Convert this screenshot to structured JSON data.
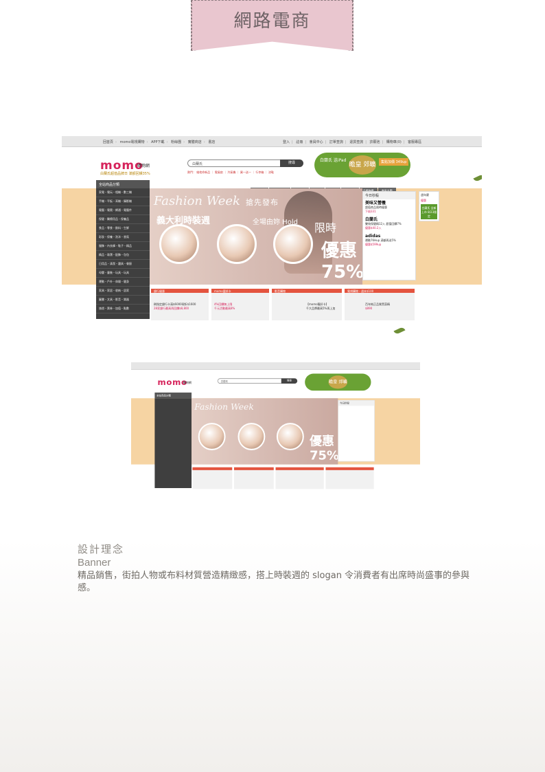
{
  "page_title": "網路電商",
  "screenshot": {
    "topbar_left": [
      "回首頁",
      "momo電視購物",
      "APP下載",
      "粉絲團",
      "實體商店",
      "書店"
    ],
    "topbar_right": [
      "登入",
      "註冊",
      "會員中心",
      "訂單查詢",
      "退貨查詢",
      "許願池",
      "購物車(0)",
      "客服專區"
    ],
    "logo": "momo",
    "logo_cn": "購物網",
    "logo_sub": "白蘭氏超值品牌日 滿額回饋35%",
    "search_value": "白蘭氏",
    "search_button": "搜尋",
    "hot_links": "熱門：  維他命新品 ｜ 電風扇 ｜ 冷氣機 ｜ 買一送一 ｜ 行李箱 ｜ 涼鞋",
    "promo": {
      "left": "白蘭氏 送iPad",
      "center": "瞻皇 郊曠師",
      "right": "集點加價 349up"
    },
    "nav_tabs": [
      "限時搶購",
      "momo書局",
      "超市美妝",
      "品牌日",
      "獨家館",
      "週末特賣",
      "品牌旗艦",
      "會員主題"
    ],
    "category_title": "全站商品分類",
    "categories": [
      "家電・電玩・相機・數三機",
      "手機・平板・耳機・攝影機",
      "電腦・電競・網通・電腦件",
      "保健・醫療用品・保養品",
      "食品・零食・飲料・生鮮",
      "彩妝・保養・洗沐・香氛",
      "服飾・內衣褲・鞋子・精品",
      "精品・珠寶・配飾・包包",
      "日用品・清潔・寢具・餐廚",
      "母嬰・童裝・玩具・玩具",
      "運動・戶外・休閒・健身",
      "家具・家居・收納・居家",
      "圖書・文具・影音・樂器",
      "旅遊・票券・加值・點數"
    ],
    "banner": {
      "script": "Fashion Week",
      "t1": "搶先發布",
      "t2": "義大利時裝週",
      "t3": "全場由妳 Hold",
      "t4": "限時",
      "t5": "優惠 75%"
    },
    "today_title": "今日秒殺",
    "today_items": [
      {
        "brand": "美味又營養",
        "desc": "超值商品限時優惠",
        "price": "下殺331"
      },
      {
        "brand": "白蘭氏",
        "desc": "雙效保健精12入 超值回饋7%",
        "price": "優惠$40.2入"
      },
      {
        "brand": "adidas",
        "desc": "運動76Hup 滿額再送5%",
        "price": "優惠$599up"
      }
    ],
    "far_right": [
      "週年慶",
      "優惠",
      "白蘭氏 全新上市 8/23限定"
    ],
    "bottom_boxes": [
      {
        "title": "銀行優惠",
        "l1": "刷指定銀行卡滿$6000現折$1600",
        "l2": "28家銀行最高再回饋$8,800"
      },
      {
        "title": "momo富邦卡",
        "l1": "4%回饋無上限",
        "l2": "千元活動最高8%"
      },
      {
        "title": "影音購物",
        "l1": "【momo龍好卡】",
        "l2": "千大品牌最高5%再上加"
      },
      {
        "title": "電視購物・週末$100",
        "l1": "百年純正品質黑蒜精",
        "l2": "$890"
      }
    ]
  },
  "concept": {
    "heading": "設計理念",
    "subheading": "Banner",
    "body": "精品銷售，街拍人物或布料材質營造精緻感，搭上時裝週的 slogan 令消費者有出席時尚盛事的參與感。"
  }
}
